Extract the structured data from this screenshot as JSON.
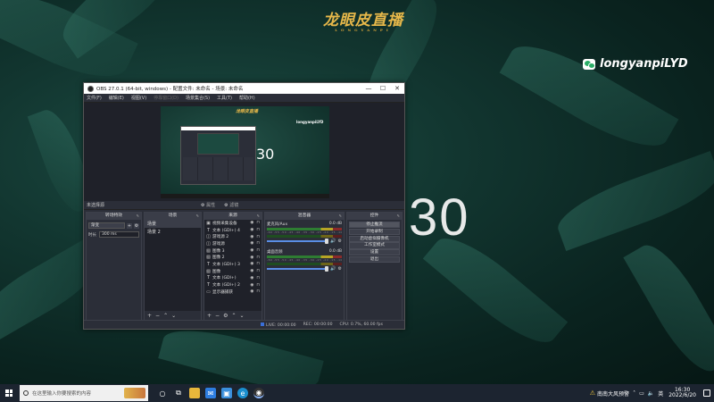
{
  "desktop": {
    "logo_text": "龙眼皮直播",
    "logo_subtext": "LONGYANPI",
    "wechat_id": "longyanpiLYD",
    "counter_text": "30"
  },
  "obs": {
    "title": "OBS 27.0.1 (64-bit, windows) - 配置文件: 未命名 - 场景: 未命名",
    "menu": [
      "文件(F)",
      "编辑(E)",
      "视图(V)",
      "停靠窗口(D)",
      "场景集合(S)",
      "工具(T)",
      "帮助(H)"
    ],
    "preview": {
      "mini_logo": "龙眼皮直播",
      "mini_wechat": "longyanpiLYD",
      "mini_counter": "30"
    },
    "current_scene_label": "未选择源",
    "properties_label": "属性",
    "filters_label": "滤镜",
    "docks": {
      "transitions": {
        "title": "转场特效",
        "selected": "渐变",
        "duration_label": "时长",
        "duration_value": "300 ms"
      },
      "scenes": {
        "title": "场景",
        "items": [
          "场景",
          "场景 2"
        ]
      },
      "sources": {
        "title": "来源",
        "items": [
          {
            "icon": "▣",
            "name": "视频采集设备"
          },
          {
            "icon": "T",
            "name": "文本 (GDI+) 4"
          },
          {
            "icon": "◫",
            "name": "游戏源 2"
          },
          {
            "icon": "◫",
            "name": "游戏源"
          },
          {
            "icon": "▧",
            "name": "图像 3"
          },
          {
            "icon": "▧",
            "name": "图像 2"
          },
          {
            "icon": "T",
            "name": "文本 (GDI+) 3"
          },
          {
            "icon": "▧",
            "name": "图像"
          },
          {
            "icon": "T",
            "name": "文本 (GDI+)"
          },
          {
            "icon": "T",
            "name": "文本 (GDI+) 2"
          },
          {
            "icon": "▭",
            "name": "显示器捕获"
          }
        ]
      },
      "mixer": {
        "title": "混音器",
        "tracks": [
          {
            "name": "麦克风/Aux",
            "db": "0.0 dB",
            "ticks": "-60 -55 -50 -45 -40 -35 -30 -25 -20 -15 -10 -5 0"
          },
          {
            "name": "桌面音频",
            "db": "0.0 dB",
            "ticks": "-60 -55 -50 -45 -40 -35 -30 -25 -20 -15 -10 -5 0"
          }
        ]
      },
      "controls": {
        "title": "控件",
        "buttons": [
          "停止推流",
          "开始录制",
          "启动虚拟摄像机",
          "工作室模式",
          "设置",
          "退出"
        ]
      }
    },
    "status": {
      "live": "LIVE: 00:00:00",
      "rec": "REC: 00:00:00",
      "cpu": "CPU: 0.7%, 60.00 fps"
    }
  },
  "taskbar": {
    "search_placeholder": "在这里输入你要搜索的内容",
    "weather": "南南大风预警",
    "lang": "英",
    "time": "16:30",
    "date": "2022/6/20"
  }
}
